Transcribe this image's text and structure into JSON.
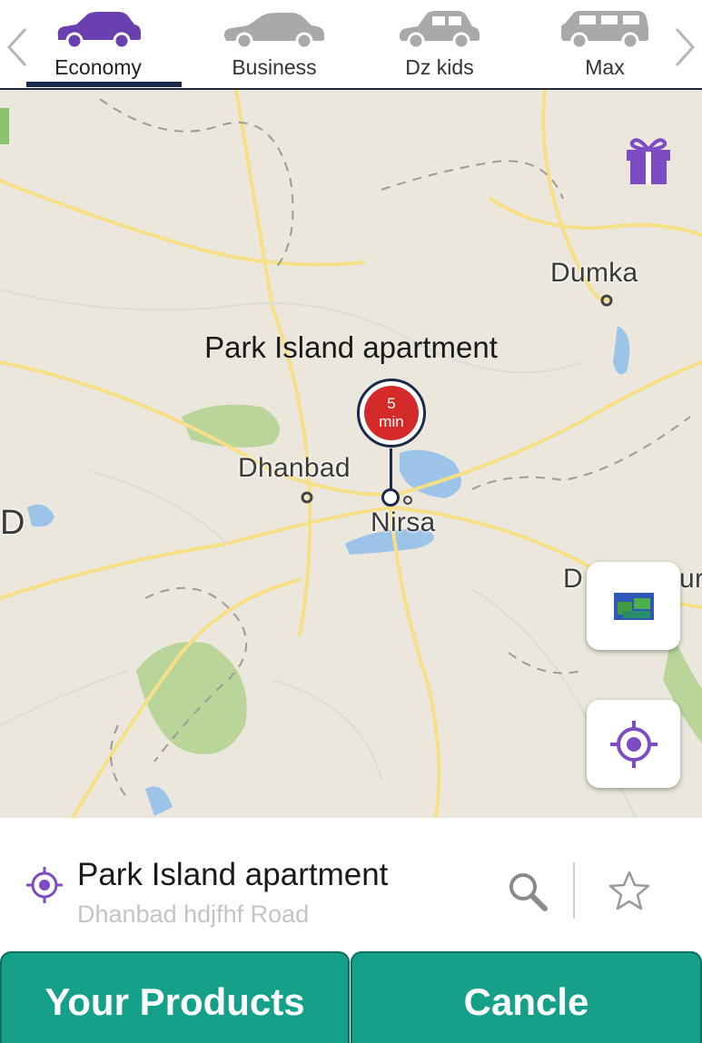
{
  "car_types": [
    {
      "label": "Economy",
      "selected": true,
      "color": "#6a3fb0"
    },
    {
      "label": "Business",
      "selected": false,
      "color": "#a9a9a9"
    },
    {
      "label": "Dz kids",
      "selected": false,
      "color": "#a9a9a9"
    },
    {
      "label": "Max",
      "selected": false,
      "color": "#a9a9a9"
    }
  ],
  "navigation": {
    "prev_icon": "chevron-left-icon",
    "next_icon": "chevron-right-icon"
  },
  "map": {
    "labels": {
      "dumka": "Dumka",
      "dhanbad": "Dhanbad",
      "nirsa": "Nirsa",
      "left_edge": "D",
      "right_edge": "D",
      "right_edge_tail": "ur"
    },
    "pickup_title": "Park Island apartment",
    "eta": {
      "value": "5",
      "unit": "min"
    },
    "gift_icon": "gift-icon",
    "layer_button_icon": "map-layer-icon",
    "locate_button_icon": "crosshair-icon"
  },
  "address": {
    "title": "Park Island apartment",
    "subtitle": "Dhanbad hdjfhf Road",
    "icon": "location-target-icon",
    "search_icon": "search-icon",
    "favorite_icon": "star-icon"
  },
  "buttons": {
    "products": "Your Products",
    "cancel": "Cancle"
  },
  "colors": {
    "accent": "#6a3fb0",
    "primary_button": "#15a08a",
    "pin_red": "#d52a2a",
    "navy": "#1b2a4a"
  }
}
